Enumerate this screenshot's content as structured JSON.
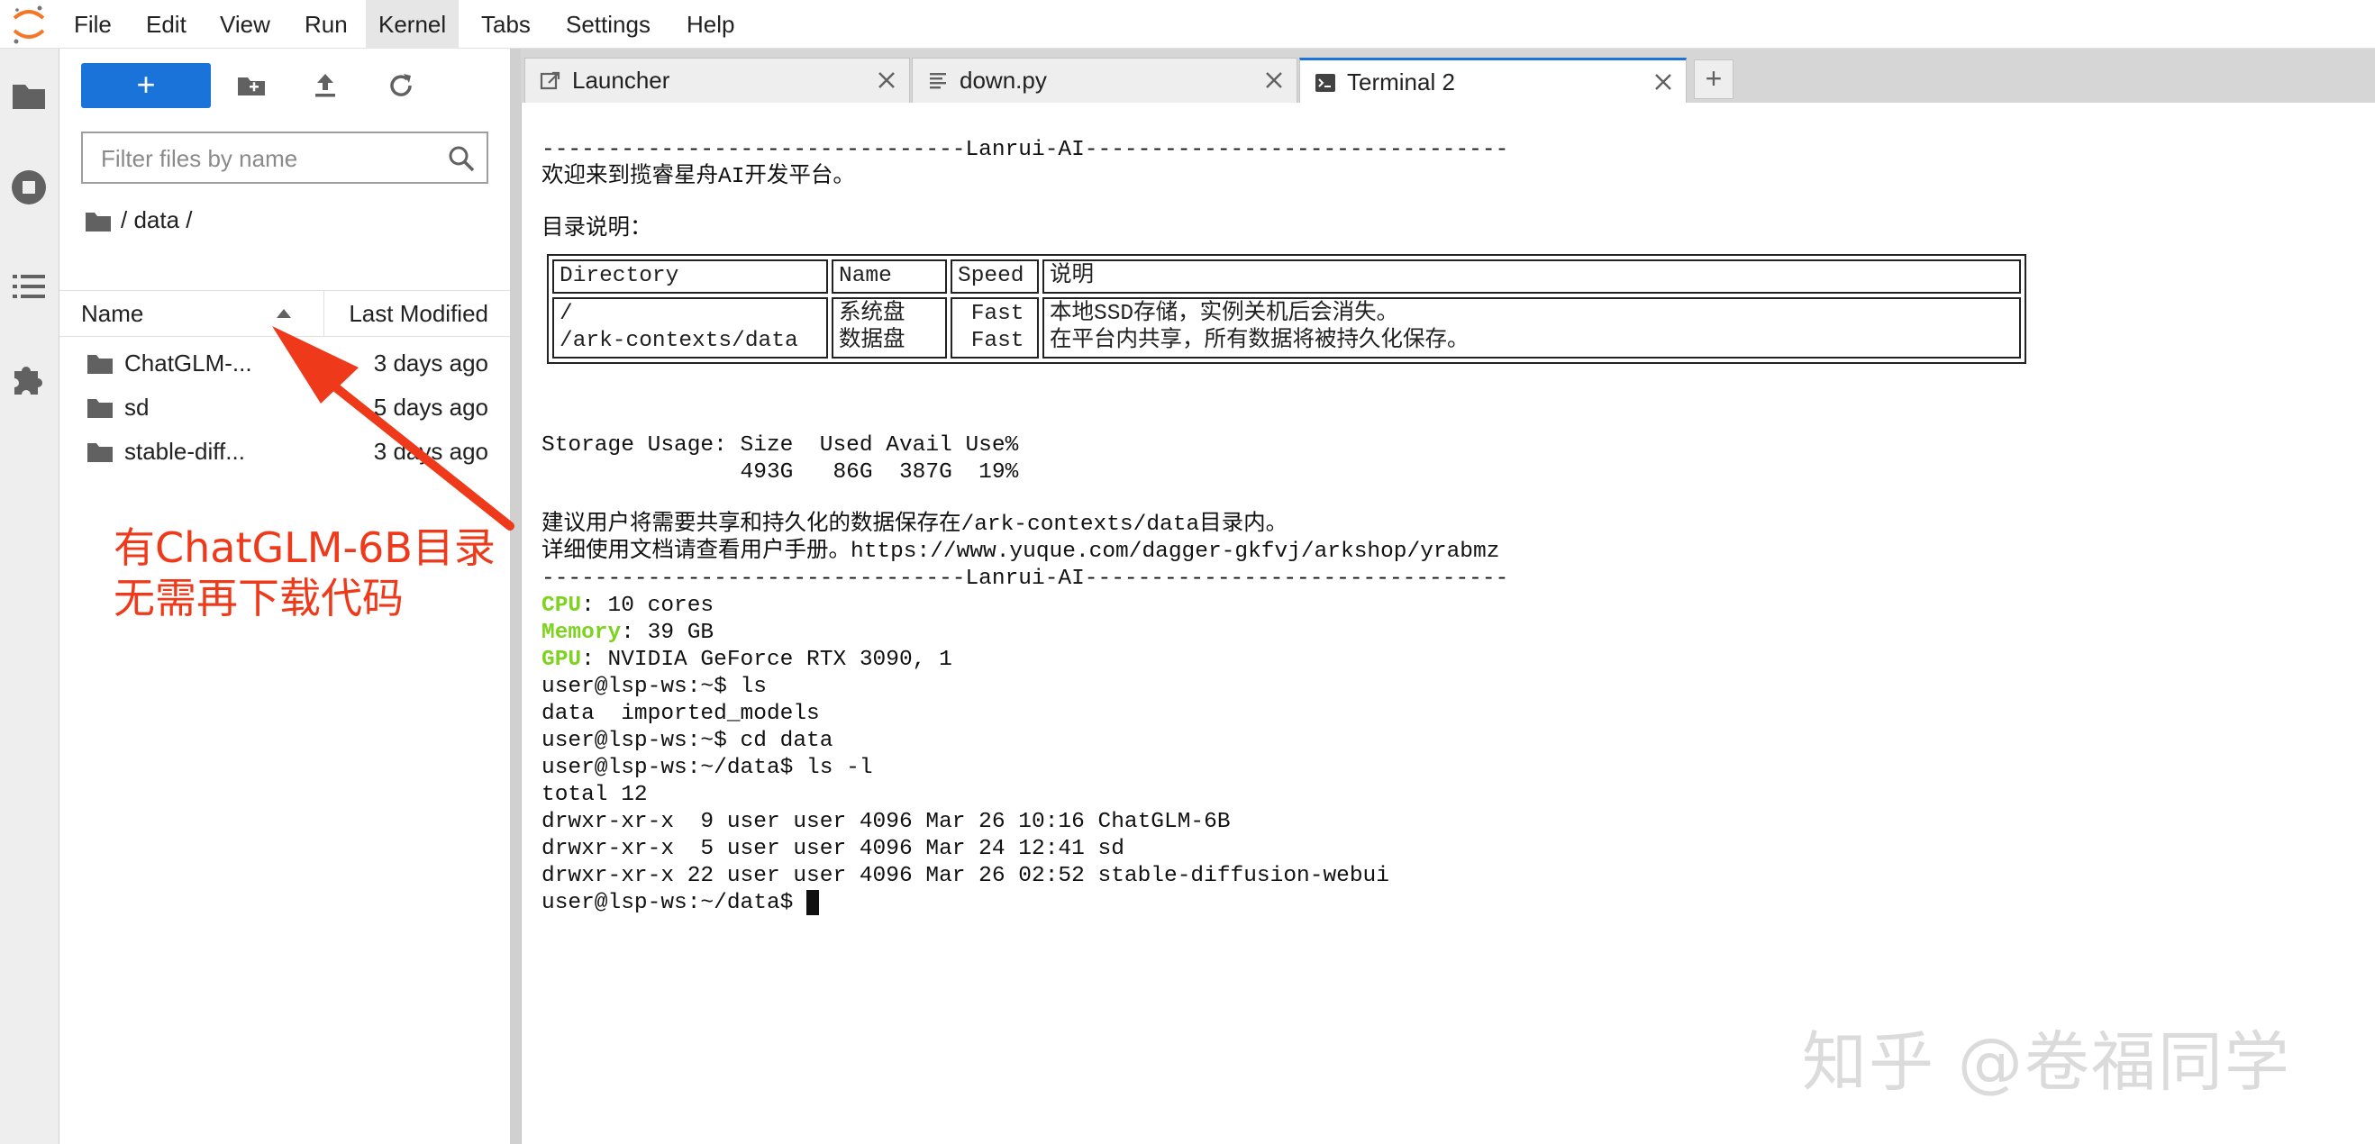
{
  "menubar": {
    "items": [
      {
        "label": "File"
      },
      {
        "label": "Edit"
      },
      {
        "label": "View"
      },
      {
        "label": "Run"
      },
      {
        "label": "Kernel"
      },
      {
        "label": "Tabs"
      },
      {
        "label": "Settings"
      },
      {
        "label": "Help"
      }
    ],
    "active_item": "Kernel"
  },
  "filebrowser": {
    "new_button_label": "+",
    "filter_placeholder": "Filter files by name",
    "breadcrumb": "/ data /",
    "columns": {
      "name": "Name",
      "modified": "Last Modified"
    },
    "items": [
      {
        "name": "ChatGLM-...",
        "modified": "3 days ago"
      },
      {
        "name": "sd",
        "modified": "5 days ago"
      },
      {
        "name": "stable-diff...",
        "modified": "3 days ago"
      }
    ]
  },
  "tabs": [
    {
      "label": "Launcher",
      "icon": "launcher-icon"
    },
    {
      "label": "down.py",
      "icon": "file-text-icon"
    },
    {
      "label": "Terminal 2",
      "icon": "terminal-icon",
      "active": true
    }
  ],
  "tab_add_label": "+",
  "terminal": {
    "banner_line": "--------------------------------Lanrui-AI--------------------------------",
    "welcome": "欢迎来到揽睿星舟AI开发平台。",
    "dir_heading": "目录说明：",
    "table_headers": [
      "Directory",
      "Name",
      "Speed",
      "说明"
    ],
    "table_row": {
      "dirs": "/\n/ark-contexts/data",
      "names": "系统盘\n数据盘",
      "speeds": " Fast\n Fast",
      "desc": "本地SSD存储，实例关机后会消失。\n在平台内共享，所有数据将被持久化保存。"
    },
    "storage_header": "Storage Usage: Size  Used Avail Use%",
    "storage_values": "               493G   86G  387G  19%",
    "advice_1": "建议用户将需要共享和持久化的数据保存在/ark-contexts/data目录内。",
    "advice_2": "详细使用文档请查看用户手册。https://www.yuque.com/dagger-gkfvj/arkshop/yrabmz",
    "cpu_label": "CPU",
    "cpu_value": ": 10 cores",
    "mem_label": "Memory",
    "mem_value": ": 39 GB",
    "gpu_label": "GPU",
    "gpu_value": ": NVIDIA GeForce RTX 3090, 1",
    "session_lines": [
      "user@lsp-ws:~$ ls",
      "data  imported_models",
      "user@lsp-ws:~$ cd data",
      "user@lsp-ws:~/data$ ls -l",
      "total 12",
      "drwxr-xr-x  9 user user 4096 Mar 26 10:16 ChatGLM-6B",
      "drwxr-xr-x  5 user user 4096 Mar 24 12:41 sd",
      "drwxr-xr-x 22 user user 4096 Mar 26 02:52 stable-diffusion-webui"
    ],
    "prompt": "user@lsp-ws:~/data$ "
  },
  "annotation": {
    "line1": "有ChatGLM-6B目录",
    "line2": "无需再下载代码",
    "color": "#ee3a1a"
  },
  "watermark": "知乎 @卷福同学"
}
